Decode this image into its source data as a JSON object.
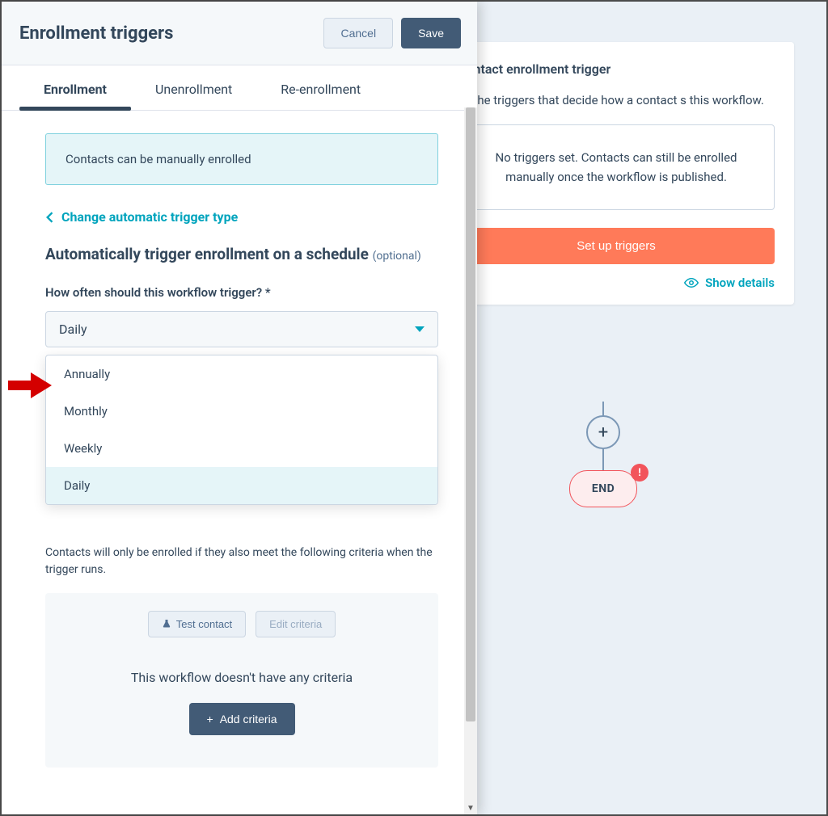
{
  "panel": {
    "title": "Enrollment triggers",
    "cancel": "Cancel",
    "save": "Save",
    "tabs": {
      "enrollment": "Enrollment",
      "unenrollment": "Unenrollment",
      "reenrollment": "Re-enrollment"
    },
    "info": "Contacts can be manually enrolled",
    "back_link": "Change automatic trigger type",
    "section_title_a": "Automatically trigger enrollment on a schedule ",
    "section_optional": "(optional)",
    "freq_label": "How often should this workflow trigger? *",
    "freq_selected": "Daily",
    "freq_options": {
      "annually": "Annually",
      "monthly": "Monthly",
      "weekly": "Weekly",
      "daily": "Daily"
    },
    "help_text": "Contacts will only be enrolled if they also meet the following criteria when the trigger runs.",
    "criteria": {
      "test": "Test contact",
      "edit": "Edit criteria",
      "empty": "This workflow doesn't have any criteria",
      "add": "Add criteria"
    }
  },
  "canvas": {
    "title": "Contact enrollment trigger",
    "desc_partial": "se the triggers that decide how a contact s this workflow.",
    "no_triggers": "No triggers set. Contacts can still be enrolled manually once the workflow is published.",
    "setup": "Set up triggers",
    "show_details": "Show details",
    "end": "END"
  }
}
